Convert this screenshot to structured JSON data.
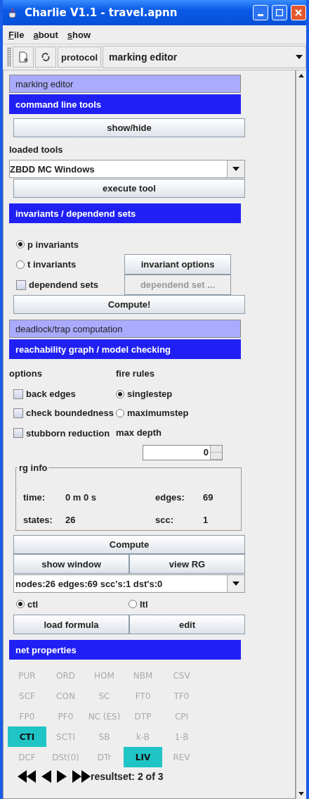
{
  "window": {
    "title": "Charlie V1.1 - travel.apnn"
  },
  "menu": [
    "File",
    "about",
    "show"
  ],
  "toolbar": {
    "protocol": "protocol",
    "editor_select": "marking editor"
  },
  "panels": [
    {
      "title": "marking editor",
      "expanded": false
    },
    {
      "title": "command line tools",
      "expanded": true,
      "kind": "tools",
      "show_hide": "show/hide",
      "loaded_label": "loaded tools",
      "tool_select": "ZBDD MC Windows",
      "execute": "execute tool"
    },
    {
      "title": "invariants / dependend sets",
      "expanded": true,
      "kind": "invariants",
      "options": [
        {
          "label": "p invariants",
          "selected": true
        },
        {
          "label": "t invariants",
          "selected": false
        }
      ],
      "invariant_options": "invariant options",
      "dependend": {
        "label": "dependend sets",
        "checked": false
      },
      "dependend_button": {
        "label": "dependend set ...",
        "disabled": true
      },
      "compute": "Compute!"
    },
    {
      "title": "deadlock/trap computation",
      "expanded": false
    },
    {
      "title": "reachability graph / model checking",
      "expanded": true,
      "kind": "reachability",
      "options_label": "options",
      "fire_rules_label": "fire rules",
      "checks": [
        {
          "label": "back edges",
          "checked": false
        },
        {
          "label": "check boundedness",
          "checked": false
        },
        {
          "label": "stubborn reduction",
          "checked": false
        }
      ],
      "fire_rules": [
        {
          "label": "singlestep",
          "selected": true
        },
        {
          "label": "maximumstep",
          "selected": false
        }
      ],
      "max_depth_label": "max depth",
      "max_depth": "0",
      "rg_info": {
        "title": "rg info",
        "fields": [
          {
            "label": "time:",
            "value": "0 m 0 s"
          },
          {
            "label": "edges:",
            "value": "69"
          },
          {
            "label": "states:",
            "value": "26"
          },
          {
            "label": "scc:",
            "value": "1"
          }
        ]
      },
      "compute": "Compute",
      "show_window": "show window",
      "view_rg": "view RG",
      "result_select": "nodes:26 edges:69 scc's:1 dst's:0",
      "logic": [
        {
          "label": "ctl",
          "selected": true
        },
        {
          "label": "ltl",
          "selected": false
        }
      ],
      "load_formula": "load formula",
      "edit": "edit"
    },
    {
      "title": "net properties",
      "expanded": true,
      "kind": "properties",
      "cells": [
        {
          "label": "PUR",
          "highlighted": false
        },
        {
          "label": "ORD",
          "highlighted": false
        },
        {
          "label": "HOM",
          "highlighted": false
        },
        {
          "label": "NBM",
          "highlighted": false
        },
        {
          "label": "CSV",
          "highlighted": false
        },
        {
          "label": "SCF",
          "highlighted": false
        },
        {
          "label": "CON",
          "highlighted": false
        },
        {
          "label": "SC",
          "highlighted": false
        },
        {
          "label": "FT0",
          "highlighted": false
        },
        {
          "label": "TF0",
          "highlighted": false
        },
        {
          "label": "FP0",
          "highlighted": false
        },
        {
          "label": "PF0",
          "highlighted": false
        },
        {
          "label": "NC (ES)",
          "highlighted": false
        },
        {
          "label": "DTP",
          "highlighted": false
        },
        {
          "label": "CPI",
          "highlighted": false
        },
        {
          "label": "CTI",
          "highlighted": true
        },
        {
          "label": "SCTI",
          "highlighted": false
        },
        {
          "label": "SB",
          "highlighted": false
        },
        {
          "label": "k-B",
          "highlighted": false
        },
        {
          "label": "1-B",
          "highlighted": false
        },
        {
          "label": "DCF",
          "highlighted": false
        },
        {
          "label": "DSt(0)",
          "highlighted": false
        },
        {
          "label": "DTr",
          "highlighted": false
        },
        {
          "label": "LIV",
          "highlighted": true
        },
        {
          "label": "REV",
          "highlighted": false
        }
      ],
      "resultset": "resultset: 2 of 3"
    }
  ]
}
